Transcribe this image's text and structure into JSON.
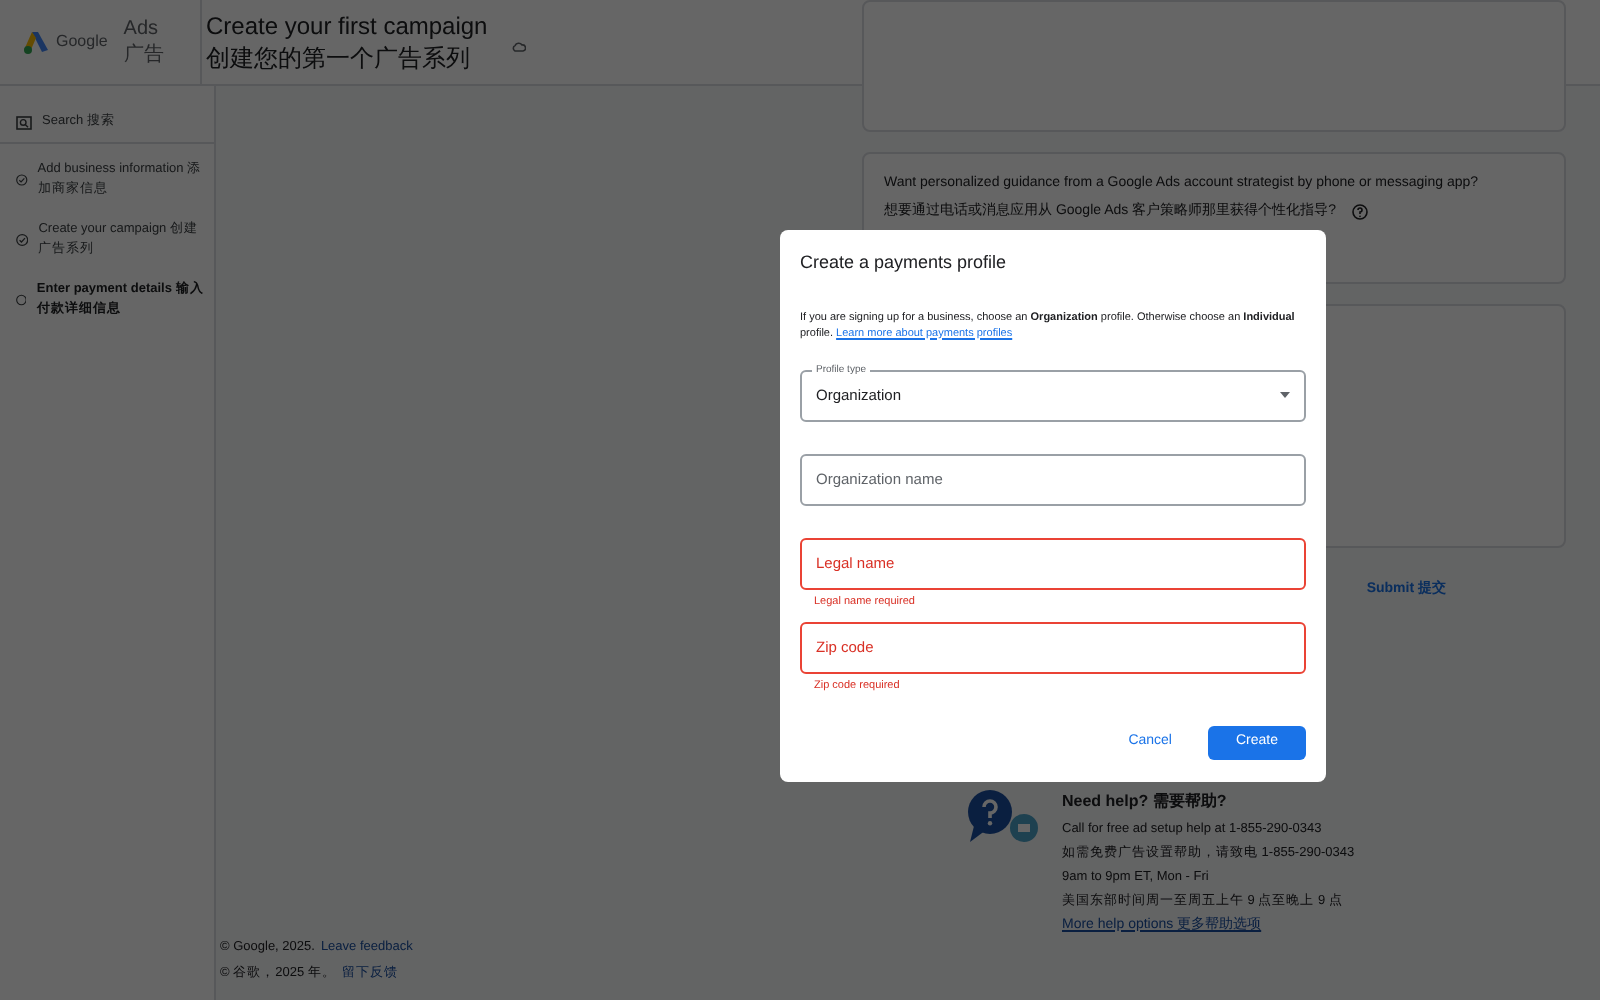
{
  "header": {
    "logo_text": "Google",
    "product": "Ads",
    "product_cn": "广告",
    "title": "Create your first campaign",
    "title_cn": "创建您的第一个广告系列"
  },
  "sidebar": {
    "items": [
      {
        "label": "Search 搜索",
        "kind": "search"
      },
      {
        "label": "Add business information 添加商家信息",
        "kind": "done"
      },
      {
        "label": "Create your campaign 创建广告系列",
        "kind": "done"
      },
      {
        "label": "Enter payment details 输入付款详细信息",
        "kind": "current"
      }
    ]
  },
  "footer": [
    {
      "text": "© Google, 2025.",
      "link": "Leave feedback"
    },
    {
      "text": "© 谷歌，2025 年。",
      "link": "留下反馈"
    }
  ],
  "guidance_card": {
    "question": "Want personalized guidance from a Google Ads account strategist by phone or messaging app?",
    "question_cn": "想要通过电话或消息应用从 Google Ads 客户策略师那里获得个性化指导?"
  },
  "submit": "Submit 提交",
  "help": {
    "title": "Need help? 需要帮助?",
    "lines": [
      "Call for free ad setup help at 1-855-290-0343",
      "如需免费广告设置帮助，请致电 1-855-290-0343",
      "9am to 9pm ET, Mon - Fri",
      "美国东部时间周一至周五上午 9 点至晚上 9 点"
    ],
    "link": "More help options 更多帮助选项"
  },
  "dialog": {
    "title": "Create a payments profile",
    "description": "If you are signing up for a business, choose an **Organization** profile. Otherwise choose an **Individual** profile.",
    "learn_more": "Learn more about payments profiles",
    "fields": [
      {
        "kind": "select",
        "label": "Profile type",
        "value": "Organization",
        "invalid": false
      },
      {
        "kind": "text",
        "placeholder": "Organization name",
        "invalid": false
      },
      {
        "kind": "text",
        "placeholder": "Legal name",
        "invalid": true,
        "error": "Legal name required"
      },
      {
        "kind": "text",
        "placeholder": "Zip code",
        "invalid": true,
        "error": "Zip code required"
      }
    ],
    "cancel": "Cancel",
    "create": "Create"
  }
}
